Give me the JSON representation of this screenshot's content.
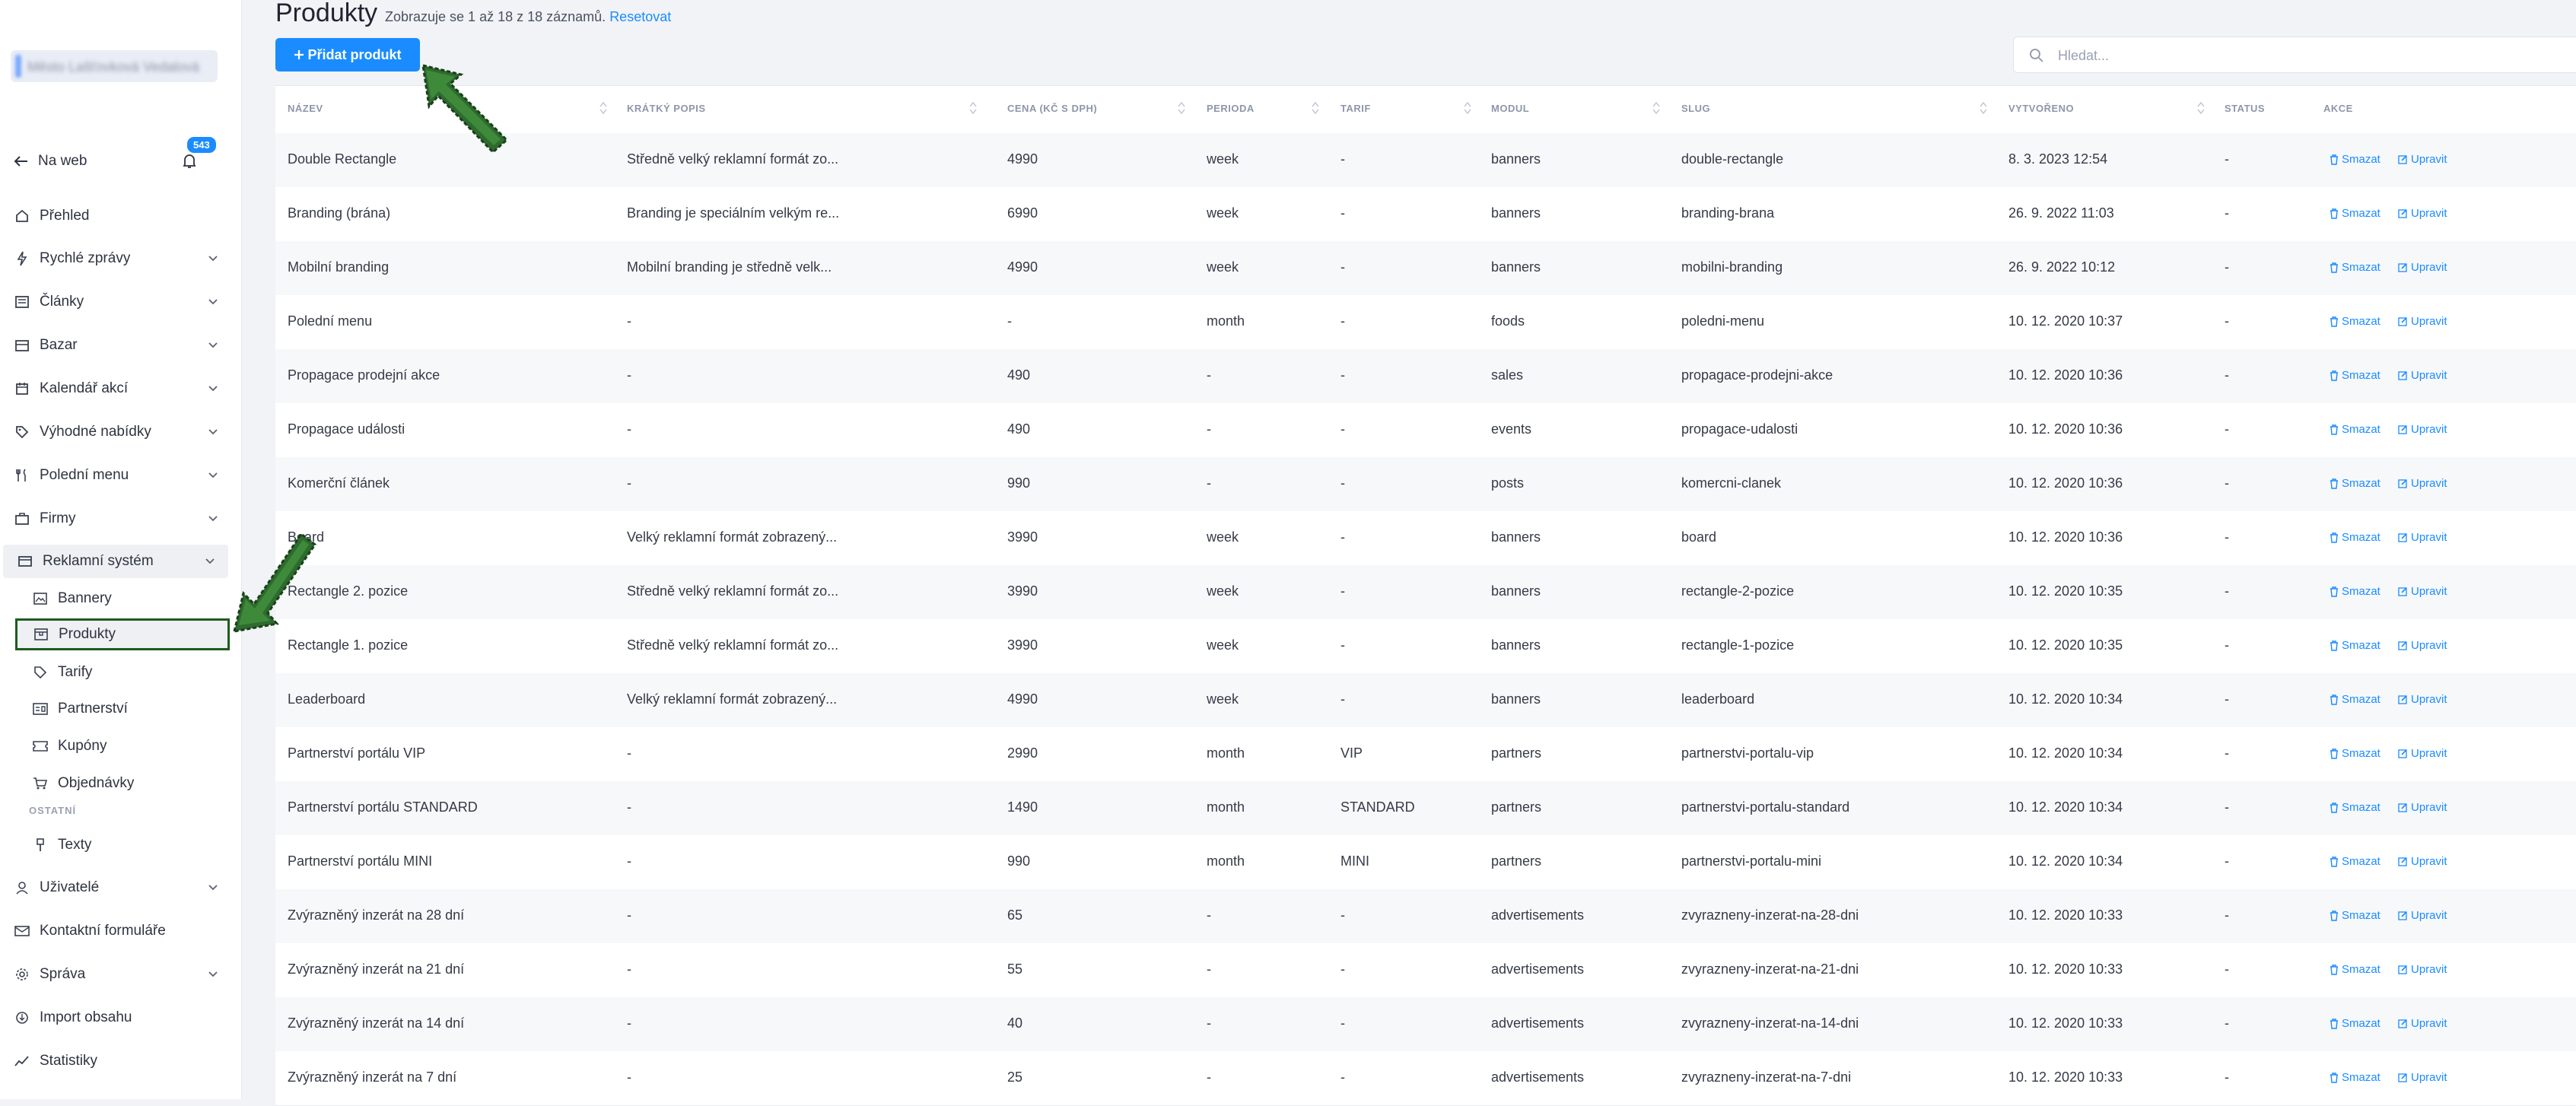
{
  "sidebar": {
    "account_name": "Město Lašťovková Vedalová",
    "back_label": "Na web",
    "notifications": "543",
    "items": [
      {
        "label": "Přehled"
      },
      {
        "label": "Rychlé zprávy"
      },
      {
        "label": "Články"
      },
      {
        "label": "Bazar"
      },
      {
        "label": "Kalendář akcí"
      },
      {
        "label": "Výhodné nabídky"
      },
      {
        "label": "Polední menu"
      },
      {
        "label": "Firmy"
      },
      {
        "label": "Reklamní systém"
      }
    ],
    "sub_items": [
      {
        "label": "Bannery"
      },
      {
        "label": "Produkty"
      },
      {
        "label": "Tarify"
      },
      {
        "label": "Partnerství"
      },
      {
        "label": "Kupóny"
      },
      {
        "label": "Objednávky"
      }
    ],
    "section_other": "OSTATNÍ",
    "texts_label": "Texty",
    "bottom_items": [
      {
        "label": "Uživatelé"
      },
      {
        "label": "Kontaktní formuláře"
      },
      {
        "label": "Správa"
      },
      {
        "label": "Import obsahu"
      },
      {
        "label": "Statistiky"
      }
    ]
  },
  "header": {
    "title": "Produkty",
    "subtitle": "Zobrazuje se 1 až 18 z 18 záznamů.",
    "reset_label": "Resetovat",
    "add_label": "Přidat produkt",
    "search_placeholder": "Hledat..."
  },
  "table": {
    "columns": [
      "NÁZEV",
      "KRÁTKÝ POPIS",
      "CENA (KČ S DPH)",
      "PERIODA",
      "TARIF",
      "MODUL",
      "SLUG",
      "VYTVOŘENO",
      "STATUS",
      "AKCE"
    ],
    "delete_label": "Smazat",
    "edit_label": "Upravit",
    "rows": [
      {
        "name": "Double Rectangle",
        "desc": "Středně velký reklamní formát zo...",
        "price": "4990",
        "period": "week",
        "tariff": "-",
        "module": "banners",
        "slug": "double-rectangle",
        "created": "8. 3. 2023 12:54",
        "status": "-"
      },
      {
        "name": "Branding (brána)",
        "desc": "Branding je speciálním velkým re...",
        "price": "6990",
        "period": "week",
        "tariff": "-",
        "module": "banners",
        "slug": "branding-brana",
        "created": "26. 9. 2022 11:03",
        "status": "-"
      },
      {
        "name": "Mobilní branding",
        "desc": "Mobilní branding je středně velk...",
        "price": "4990",
        "period": "week",
        "tariff": "-",
        "module": "banners",
        "slug": "mobilni-branding",
        "created": "26. 9. 2022 10:12",
        "status": "-"
      },
      {
        "name": "Polední menu",
        "desc": "-",
        "price": "-",
        "period": "month",
        "tariff": "-",
        "module": "foods",
        "slug": "poledni-menu",
        "created": "10. 12. 2020 10:37",
        "status": "-"
      },
      {
        "name": "Propagace prodejní akce",
        "desc": "-",
        "price": "490",
        "period": "-",
        "tariff": "-",
        "module": "sales",
        "slug": "propagace-prodejni-akce",
        "created": "10. 12. 2020 10:36",
        "status": "-"
      },
      {
        "name": "Propagace události",
        "desc": "-",
        "price": "490",
        "period": "-",
        "tariff": "-",
        "module": "events",
        "slug": "propagace-udalosti",
        "created": "10. 12. 2020 10:36",
        "status": "-"
      },
      {
        "name": "Komerční článek",
        "desc": "-",
        "price": "990",
        "period": "-",
        "tariff": "-",
        "module": "posts",
        "slug": "komercni-clanek",
        "created": "10. 12. 2020 10:36",
        "status": "-"
      },
      {
        "name": "Board",
        "desc": "Velký reklamní formát zobrazený...",
        "price": "3990",
        "period": "week",
        "tariff": "-",
        "module": "banners",
        "slug": "board",
        "created": "10. 12. 2020 10:36",
        "status": "-"
      },
      {
        "name": "Rectangle 2. pozice",
        "desc": "Středně velký reklamní formát zo...",
        "price": "3990",
        "period": "week",
        "tariff": "-",
        "module": "banners",
        "slug": "rectangle-2-pozice",
        "created": "10. 12. 2020 10:35",
        "status": "-"
      },
      {
        "name": "Rectangle 1. pozice",
        "desc": "Středně velký reklamní formát zo...",
        "price": "3990",
        "period": "week",
        "tariff": "-",
        "module": "banners",
        "slug": "rectangle-1-pozice",
        "created": "10. 12. 2020 10:35",
        "status": "-"
      },
      {
        "name": "Leaderboard",
        "desc": "Velký reklamní formát zobrazený...",
        "price": "4990",
        "period": "week",
        "tariff": "-",
        "module": "banners",
        "slug": "leaderboard",
        "created": "10. 12. 2020 10:34",
        "status": "-"
      },
      {
        "name": "Partnerství portálu VIP",
        "desc": "-",
        "price": "2990",
        "period": "month",
        "tariff": "VIP",
        "module": "partners",
        "slug": "partnerstvi-portalu-vip",
        "created": "10. 12. 2020 10:34",
        "status": "-"
      },
      {
        "name": "Partnerství portálu STANDARD",
        "desc": "-",
        "price": "1490",
        "period": "month",
        "tariff": "STANDARD",
        "module": "partners",
        "slug": "partnerstvi-portalu-standard",
        "created": "10. 12. 2020 10:34",
        "status": "-"
      },
      {
        "name": "Partnerství portálu MINI",
        "desc": "-",
        "price": "990",
        "period": "month",
        "tariff": "MINI",
        "module": "partners",
        "slug": "partnerstvi-portalu-mini",
        "created": "10. 12. 2020 10:34",
        "status": "-"
      },
      {
        "name": "Zvýrazněný inzerát na 28 dní",
        "desc": "-",
        "price": "65",
        "period": "-",
        "tariff": "-",
        "module": "advertisements",
        "slug": "zvyrazneny-inzerat-na-28-dni",
        "created": "10. 12. 2020 10:33",
        "status": "-"
      },
      {
        "name": "Zvýrazněný inzerát na 21 dní",
        "desc": "-",
        "price": "55",
        "period": "-",
        "tariff": "-",
        "module": "advertisements",
        "slug": "zvyrazneny-inzerat-na-21-dni",
        "created": "10. 12. 2020 10:33",
        "status": "-"
      },
      {
        "name": "Zvýrazněný inzerát na 14 dní",
        "desc": "-",
        "price": "40",
        "period": "-",
        "tariff": "-",
        "module": "advertisements",
        "slug": "zvyrazneny-inzerat-na-14-dni",
        "created": "10. 12. 2020 10:33",
        "status": "-"
      },
      {
        "name": "Zvýrazněný inzerát na 7 dní",
        "desc": "-",
        "price": "25",
        "period": "-",
        "tariff": "-",
        "module": "advertisements",
        "slug": "zvyrazneny-inzerat-na-7-dni",
        "created": "10. 12. 2020 10:33",
        "status": "-"
      }
    ]
  },
  "colors": {
    "accent": "#1a8cff",
    "annotation": "#1f5b1f"
  }
}
